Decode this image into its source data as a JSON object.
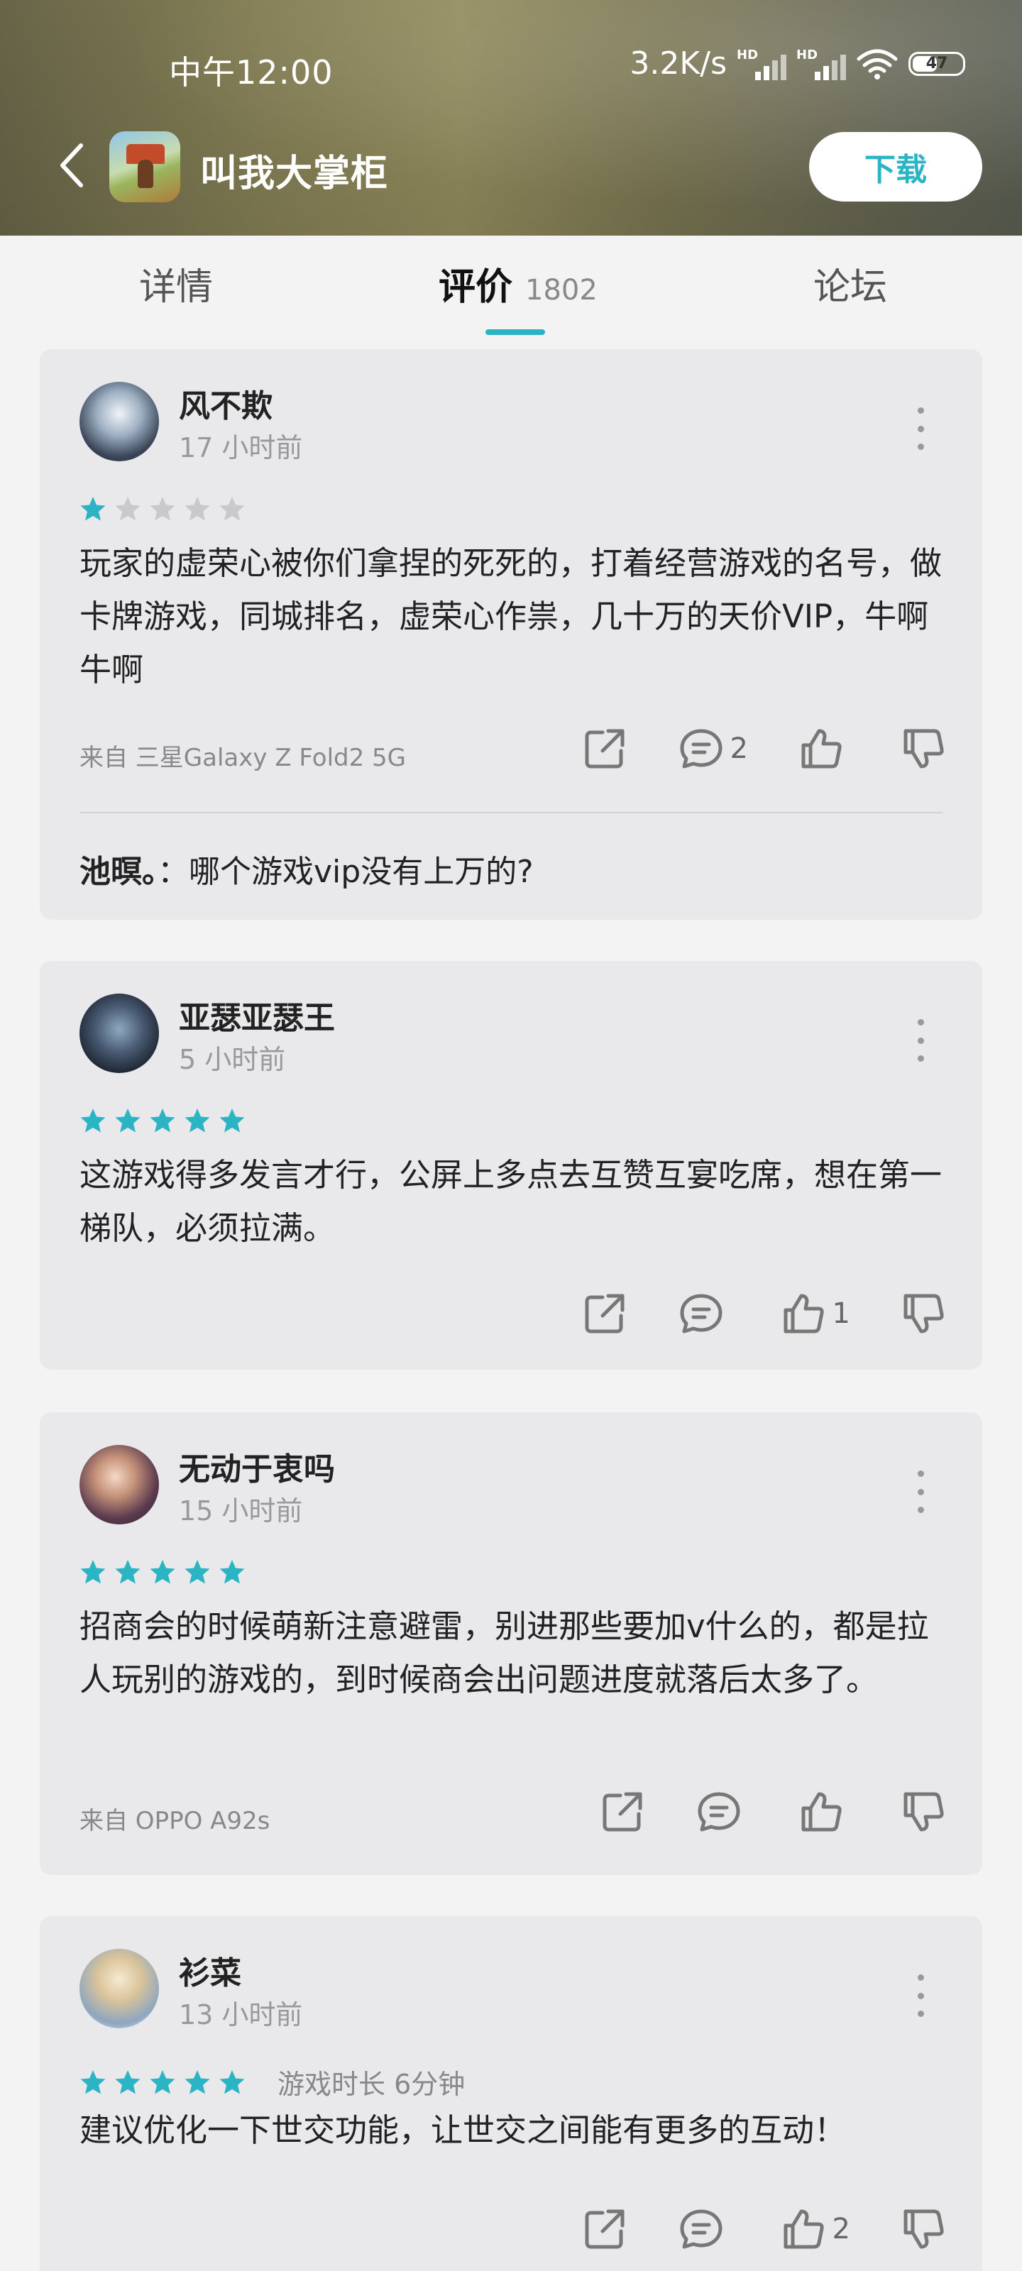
{
  "status_bar": {
    "time": "中午12:00",
    "net_speed": "3.2K/s",
    "signal_label": "HD",
    "battery": "47"
  },
  "app_bar": {
    "title": "叫我大掌柜",
    "download_label": "下载"
  },
  "tabs": {
    "details": "详情",
    "reviews": "评价",
    "reviews_count": "1802",
    "forum": "论坛"
  },
  "colors": {
    "accent": "#2bb4c4",
    "star_off": "#c9c9cc"
  },
  "reviews": [
    {
      "username": "风不欺",
      "time": "17 小时前",
      "rating": 1,
      "text": "玩家的虚荣心被你们拿捏的死死的，打着经营游戏的名号，做卡牌游戏，同城排名，虚荣心作祟，几十万的天价VIP，牛啊牛啊",
      "device": "来自 三星Galaxy Z Fold2 5G",
      "comment_count": "2",
      "like_count": "",
      "reply_author": "池暝。",
      "reply_text": "：哪个游戏vip没有上万的?"
    },
    {
      "username": "亚瑟亚瑟王",
      "time": "5 小时前",
      "rating": 5,
      "text": "这游戏得多发言才行，公屏上多点去互赞互宴吃席，想在第一梯队，必须拉满。",
      "device": "",
      "comment_count": "",
      "like_count": "1"
    },
    {
      "username": "无动于衷吗",
      "time": "15 小时前",
      "rating": 5,
      "text": "招商会的时候萌新注意避雷，别进那些要加v什么的，都是拉人玩别的游戏的，到时候商会出问题进度就落后太多了。",
      "device": "来自 OPPO A92s",
      "comment_count": "",
      "like_count": ""
    },
    {
      "username": "衫菜",
      "time": "13 小时前",
      "rating": 5,
      "playtime": "游戏时长 6分钟",
      "text": "建议优化一下世交功能，让世交之间能有更多的互动！",
      "device": "",
      "comment_count": "",
      "like_count": "2"
    }
  ]
}
